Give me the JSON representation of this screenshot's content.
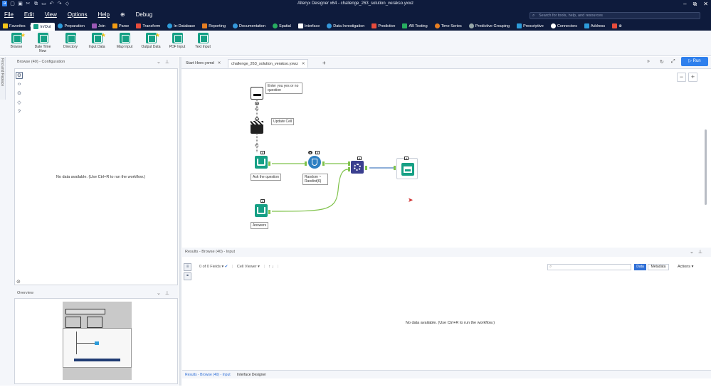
{
  "app": {
    "title": "Alteryx Designer x64 - challenge_263_solution_verakso.yxwz"
  },
  "menu": [
    "File",
    "Edit",
    "View",
    "Options",
    "Help",
    "Debug"
  ],
  "search": {
    "placeholder": "Search for tools, help, and resources"
  },
  "categories": [
    {
      "label": "Favorites",
      "color": "#f5c518"
    },
    {
      "label": "In/Out",
      "color": "#16a085",
      "active": true
    },
    {
      "label": "Preparation",
      "color": "#2d9cdb"
    },
    {
      "label": "Join",
      "color": "#9b59b6"
    },
    {
      "label": "Parse",
      "color": "#f39c12"
    },
    {
      "label": "Transform",
      "color": "#e74c3c"
    },
    {
      "label": "In-Database",
      "color": "#2d9cdb"
    },
    {
      "label": "Reporting",
      "color": "#e67e22"
    },
    {
      "label": "Documentation",
      "color": "#3498db"
    },
    {
      "label": "Spatial",
      "color": "#27ae60"
    },
    {
      "label": "Interface",
      "color": "#ffffff"
    },
    {
      "label": "Data Investigation",
      "color": "#3498db"
    },
    {
      "label": "Predictive",
      "color": "#e74c3c"
    },
    {
      "label": "AB Testing",
      "color": "#27ae60"
    },
    {
      "label": "Time Series",
      "color": "#e67e22"
    },
    {
      "label": "Predictive Grouping",
      "color": "#95a5a6"
    },
    {
      "label": "Prescriptive",
      "color": "#2d9cdb"
    },
    {
      "label": "Connectors",
      "color": "#ffffff"
    },
    {
      "label": "Address",
      "color": "#2d9cdb"
    }
  ],
  "palette": [
    {
      "label": "Browse",
      "color": "#16a085",
      "star": true
    },
    {
      "label": "Date Time Now",
      "color": "#16a085"
    },
    {
      "label": "Directory",
      "color": "#16a085"
    },
    {
      "label": "Input Data",
      "color": "#16a085",
      "star": true
    },
    {
      "label": "Map Input",
      "color": "#16a085"
    },
    {
      "label": "Output Data",
      "color": "#16a085",
      "star": true
    },
    {
      "label": "PDF Input",
      "color": "#16a085"
    },
    {
      "label": "Text Input",
      "color": "#16a085"
    }
  ],
  "left_panel": {
    "vertical_tab": "Find and Replace",
    "config_header": "Browse (40) - Configuration",
    "config_message": "No data available. (Use Ctrl+R to run the workflow.)",
    "overview_header": "Overview"
  },
  "tabs": [
    {
      "label": "Start Here.yxmd"
    },
    {
      "label": "challenge_263_solution_verakso.yxwz",
      "active": true
    }
  ],
  "run_label": "Run",
  "workflow": {
    "nodes": [
      {
        "label": "Enter you yes or no question"
      },
      {
        "label": "Update Cell"
      },
      {
        "label": "Ask the question"
      },
      {
        "label": "Random ~ Randint(6)"
      },
      {
        "label": "Answers"
      }
    ],
    "badge_hash": "#1"
  },
  "results": {
    "header": "Results - Browse (40) - Input",
    "fields": "0 of 0 Fields",
    "cell_viewer": "Cell Viewer",
    "data_tab": "Data",
    "metadata_tab": "Metadata",
    "actions": "Actions",
    "message": "No data available. (Use Ctrl+R to run the workflow.)"
  },
  "bottom_tabs": [
    "Results - Browse (40) - Input",
    "Interface Designer"
  ]
}
